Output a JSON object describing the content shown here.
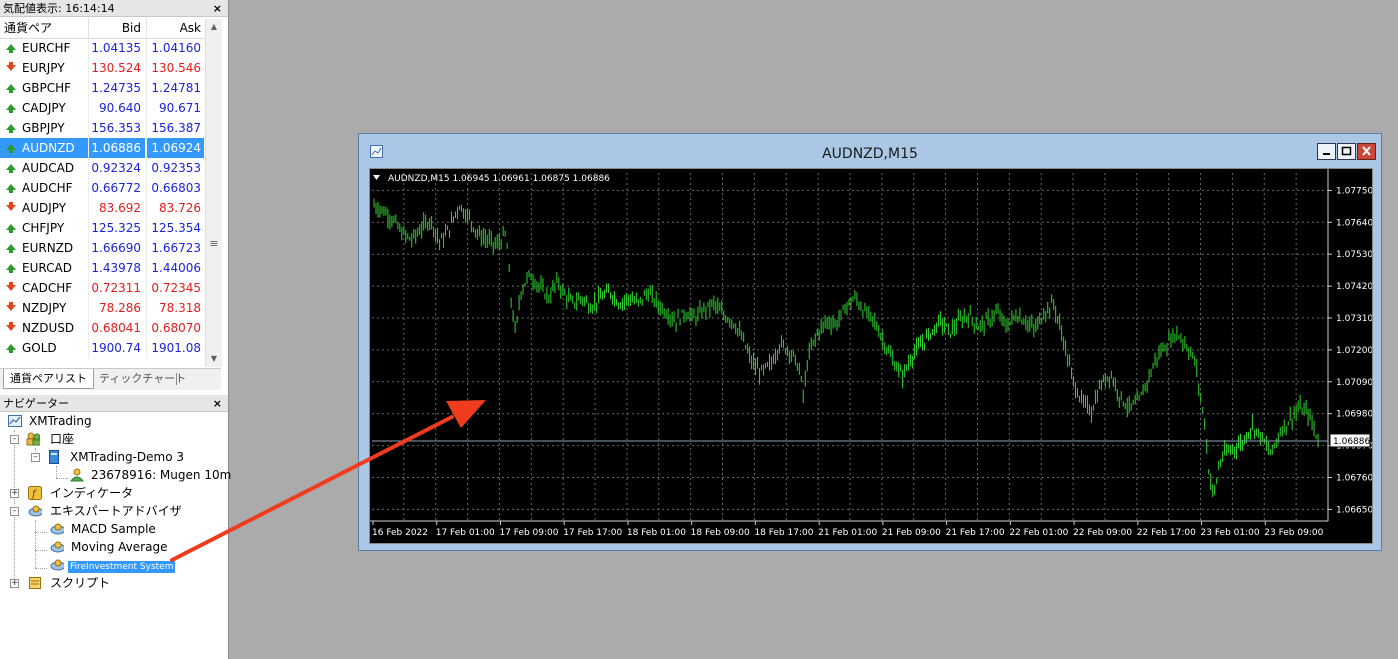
{
  "market_watch": {
    "title": "気配値表示: 16:14:14",
    "close": "×",
    "col_symbol": "通貨ペア",
    "col_bid": "Bid",
    "col_ask": "Ask",
    "rows": [
      {
        "symbol": "EURCHF",
        "bid": "1.04135",
        "ask": "1.04160",
        "dir": "up",
        "color": "#1a24d8"
      },
      {
        "symbol": "EURJPY",
        "bid": "130.524",
        "ask": "130.546",
        "dir": "down",
        "color": "#e61c1c"
      },
      {
        "symbol": "GBPCHF",
        "bid": "1.24735",
        "ask": "1.24781",
        "dir": "up",
        "color": "#1a24d8"
      },
      {
        "symbol": "CADJPY",
        "bid": "90.640",
        "ask": "90.671",
        "dir": "up",
        "color": "#1a24d8"
      },
      {
        "symbol": "GBPJPY",
        "bid": "156.353",
        "ask": "156.387",
        "dir": "up",
        "color": "#1a24d8"
      },
      {
        "symbol": "AUDNZD",
        "bid": "1.06886",
        "ask": "1.06924",
        "dir": "up",
        "color": "#ffffff",
        "selected": true
      },
      {
        "symbol": "AUDCAD",
        "bid": "0.92324",
        "ask": "0.92353",
        "dir": "up",
        "color": "#1a24d8"
      },
      {
        "symbol": "AUDCHF",
        "bid": "0.66772",
        "ask": "0.66803",
        "dir": "up",
        "color": "#1a24d8"
      },
      {
        "symbol": "AUDJPY",
        "bid": "83.692",
        "ask": "83.726",
        "dir": "down",
        "color": "#e61c1c"
      },
      {
        "symbol": "CHFJPY",
        "bid": "125.325",
        "ask": "125.354",
        "dir": "up",
        "color": "#1a24d8"
      },
      {
        "symbol": "EURNZD",
        "bid": "1.66690",
        "ask": "1.66723",
        "dir": "up",
        "color": "#1a24d8"
      },
      {
        "symbol": "EURCAD",
        "bid": "1.43978",
        "ask": "1.44006",
        "dir": "up",
        "color": "#1a24d8"
      },
      {
        "symbol": "CADCHF",
        "bid": "0.72311",
        "ask": "0.72345",
        "dir": "down",
        "color": "#e61c1c"
      },
      {
        "symbol": "NZDJPY",
        "bid": "78.286",
        "ask": "78.318",
        "dir": "down",
        "color": "#e61c1c"
      },
      {
        "symbol": "NZDUSD",
        "bid": "0.68041",
        "ask": "0.68070",
        "dir": "down",
        "color": "#e61c1c"
      },
      {
        "symbol": "GOLD",
        "bid": "1900.74",
        "ask": "1901.08",
        "dir": "up",
        "color": "#1a24d8"
      }
    ],
    "tabs": [
      "通貨ペアリスト",
      "ティックチャート"
    ]
  },
  "navigator": {
    "title": "ナビゲーター",
    "close": "×",
    "root": "XMTrading",
    "accounts": "口座",
    "server": "XMTrading-Demo 3",
    "account": "23678916: Mugen 10m",
    "indicators": "インディケータ",
    "experts": "エキスパートアドバイザ",
    "expert_items": [
      "MACD Sample",
      "Moving Average",
      "FireInvestment System"
    ],
    "scripts": "スクリプト"
  },
  "chart_window": {
    "title": "AUDNZD,M15",
    "info": "AUDNZD,M15  1.06945 1.06961 1.06875 1.06886",
    "current_price": "1.06886",
    "candle_color": "#2fd52f",
    "chart_data": {
      "type": "line",
      "symbol": "AUDNZD",
      "timeframe": "M15",
      "ohlc_last": {
        "open": 1.06945,
        "high": 1.06961,
        "low": 1.06875,
        "close": 1.06886
      },
      "ylim": [
        1.0661,
        1.0781
      ],
      "y_ticks": [
        "1.07750",
        "1.07640",
        "1.07530",
        "1.07420",
        "1.07310",
        "1.07200",
        "1.07090",
        "1.06980",
        "1.06870",
        "1.06760",
        "1.06650"
      ],
      "y_tick_values": [
        1.0775,
        1.0764,
        1.0753,
        1.0742,
        1.0731,
        1.072,
        1.0709,
        1.0698,
        1.0687,
        1.0676,
        1.0665
      ],
      "x_ticks": [
        "16 Feb 2022",
        "17 Feb 01:00",
        "17 Feb 09:00",
        "17 Feb 17:00",
        "18 Feb 01:00",
        "18 Feb 09:00",
        "18 Feb 17:00",
        "21 Feb 01:00",
        "21 Feb 09:00",
        "21 Feb 17:00",
        "22 Feb 01:00",
        "22 Feb 09:00",
        "22 Feb 17:00",
        "23 Feb 01:00",
        "23 Feb 09:00"
      ],
      "grid": true,
      "price_path": [
        [
          0,
          1.077
        ],
        [
          2,
          1.0768
        ],
        [
          4,
          1.0765
        ],
        [
          6,
          1.076
        ],
        [
          8,
          1.0758
        ],
        [
          10,
          1.0762
        ],
        [
          12,
          1.0765
        ],
        [
          14,
          1.0757
        ],
        [
          16,
          1.0762
        ],
        [
          18,
          1.077
        ],
        [
          20,
          1.0766
        ],
        [
          22,
          1.076
        ],
        [
          24,
          1.0758
        ],
        [
          26,
          1.0756
        ],
        [
          28,
          1.076
        ],
        [
          29,
          1.0738
        ],
        [
          30,
          1.0725
        ],
        [
          31,
          1.074
        ],
        [
          33,
          1.0746
        ],
        [
          35,
          1.0742
        ],
        [
          37,
          1.0738
        ],
        [
          39,
          1.0744
        ],
        [
          40,
          1.074
        ],
        [
          42,
          1.0736
        ],
        [
          44,
          1.0738
        ],
        [
          46,
          1.0735
        ],
        [
          48,
          1.0738
        ],
        [
          50,
          1.074
        ],
        [
          52,
          1.0736
        ],
        [
          54,
          1.0738
        ],
        [
          56,
          1.0736
        ],
        [
          58,
          1.074
        ],
        [
          60,
          1.0736
        ],
        [
          62,
          1.0733
        ],
        [
          64,
          1.073
        ],
        [
          66,
          1.0733
        ],
        [
          68,
          1.0731
        ],
        [
          70,
          1.0734
        ],
        [
          72,
          1.0736
        ],
        [
          74,
          1.0732
        ],
        [
          76,
          1.073
        ],
        [
          78,
          1.0724
        ],
        [
          80,
          1.0716
        ],
        [
          82,
          1.0712
        ],
        [
          84,
          1.0715
        ],
        [
          86,
          1.0722
        ],
        [
          88,
          1.072
        ],
        [
          90,
          1.0714
        ],
        [
          91,
          1.0704
        ],
        [
          92,
          1.0718
        ],
        [
          94,
          1.0726
        ],
        [
          96,
          1.073
        ],
        [
          98,
          1.0729
        ],
        [
          100,
          1.0735
        ],
        [
          102,
          1.0738
        ],
        [
          104,
          1.0733
        ],
        [
          106,
          1.073
        ],
        [
          108,
          1.0723
        ],
        [
          110,
          1.0716
        ],
        [
          112,
          1.0711
        ],
        [
          114,
          1.0718
        ],
        [
          116,
          1.0722
        ],
        [
          118,
          1.0726
        ],
        [
          120,
          1.073
        ],
        [
          122,
          1.0726
        ],
        [
          124,
          1.073
        ],
        [
          126,
          1.0732
        ],
        [
          128,
          1.0728
        ],
        [
          130,
          1.073
        ],
        [
          132,
          1.0733
        ],
        [
          134,
          1.0728
        ],
        [
          136,
          1.0732
        ],
        [
          138,
          1.073
        ],
        [
          140,
          1.0727
        ],
        [
          142,
          1.0733
        ],
        [
          144,
          1.0736
        ],
        [
          146,
          1.0724
        ],
        [
          148,
          1.071
        ],
        [
          150,
          1.0702
        ],
        [
          152,
          1.0699
        ],
        [
          154,
          1.0708
        ],
        [
          156,
          1.0712
        ],
        [
          158,
          1.0704
        ],
        [
          160,
          1.07
        ],
        [
          162,
          1.0702
        ],
        [
          164,
          1.071
        ],
        [
          166,
          1.0718
        ],
        [
          168,
          1.0722
        ],
        [
          170,
          1.0726
        ],
        [
          172,
          1.0722
        ],
        [
          174,
          1.0716
        ],
        [
          175,
          1.0705
        ],
        [
          176,
          1.0695
        ],
        [
          177,
          1.0676
        ],
        [
          178,
          1.067
        ],
        [
          179,
          1.068
        ],
        [
          180,
          1.0684
        ],
        [
          182,
          1.0686
        ],
        [
          184,
          1.0688
        ],
        [
          186,
          1.0694
        ],
        [
          188,
          1.069
        ],
        [
          190,
          1.0684
        ],
        [
          192,
          1.0692
        ],
        [
          194,
          1.0696
        ],
        [
          196,
          1.07
        ],
        [
          198,
          1.0698
        ],
        [
          200,
          1.0689
        ]
      ]
    }
  },
  "colors": {
    "workspace": "#ababab",
    "bid_up": "#1a24d8",
    "bid_down": "#e61c1c",
    "selected_row": "#3399ff",
    "annotation_arrow": "#f03c1e",
    "chart_grid": "#6a6a6a"
  }
}
